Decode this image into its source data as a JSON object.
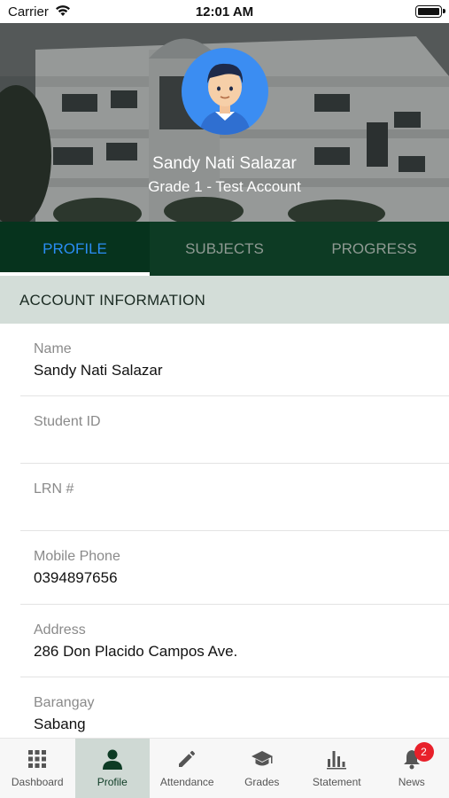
{
  "status_bar": {
    "carrier": "Carrier",
    "time": "12:01 AM"
  },
  "profile": {
    "name": "Sandy Nati Salazar",
    "grade": "Grade 1 - Test Account"
  },
  "tabs": [
    {
      "label": "PROFILE",
      "active": true
    },
    {
      "label": "SUBJECTS",
      "active": false
    },
    {
      "label": "PROGRESS",
      "active": false
    }
  ],
  "section": {
    "title": "ACCOUNT INFORMATION"
  },
  "fields": [
    {
      "label": "Name",
      "value": "Sandy Nati Salazar"
    },
    {
      "label": "Student ID",
      "value": ""
    },
    {
      "label": "LRN #",
      "value": ""
    },
    {
      "label": "Mobile Phone",
      "value": "0394897656"
    },
    {
      "label": "Address",
      "value": "286 Don Placido Campos Ave."
    },
    {
      "label": "Barangay",
      "value": "Sabang"
    }
  ],
  "nav": [
    {
      "label": "Dashboard",
      "icon": "grid-icon",
      "active": false
    },
    {
      "label": "Profile",
      "icon": "person-icon",
      "active": true
    },
    {
      "label": "Attendance",
      "icon": "pencil-icon",
      "active": false
    },
    {
      "label": "Grades",
      "icon": "graduation-cap-icon",
      "active": false
    },
    {
      "label": "Statement",
      "icon": "bar-chart-icon",
      "active": false
    },
    {
      "label": "News",
      "icon": "bell-icon",
      "active": false,
      "badge": "2"
    }
  ],
  "colors": {
    "tab_bar": "#0d3b24",
    "active_tab_text": "#2a8df4",
    "section_header_bg": "#d3ddd8",
    "avatar_bg": "#3b8df2",
    "badge": "#e8202a"
  }
}
